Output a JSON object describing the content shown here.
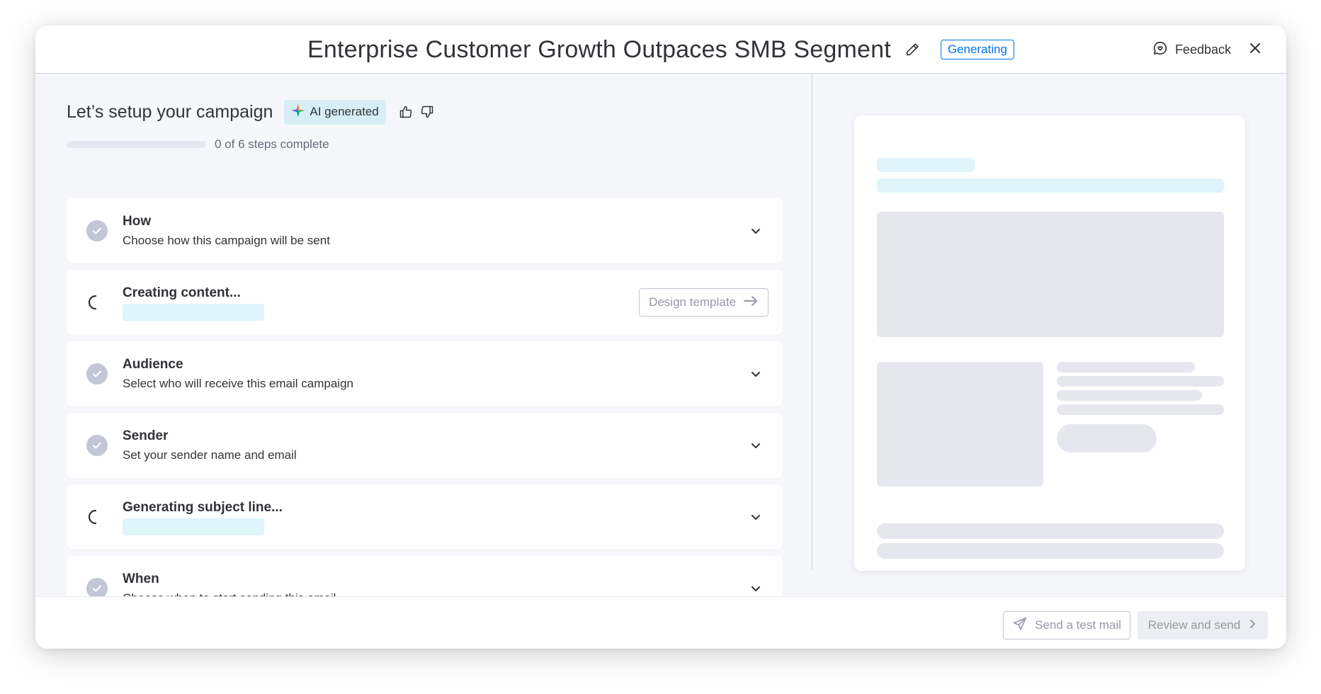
{
  "header": {
    "title": "Enterprise Customer Growth Outpaces SMB Segment",
    "status": "Generating",
    "feedback_label": "Feedback",
    "edit_icon": "pencil-icon",
    "close_icon": "close-icon"
  },
  "setup": {
    "title": "Let’s setup your campaign",
    "ai_badge": "AI generated",
    "progress_fraction": 0,
    "progress_text": "0 of 6 steps complete"
  },
  "steps": [
    {
      "title": "How",
      "subtitle": "Choose how this campaign will be sent",
      "state": "done"
    },
    {
      "title": "Creating content...",
      "subtitle": "",
      "state": "loading",
      "action_label": "Design template"
    },
    {
      "title": "Audience",
      "subtitle": "Select who will receive this email campaign",
      "state": "done"
    },
    {
      "title": "Sender",
      "subtitle": "Set your sender name and email",
      "state": "done"
    },
    {
      "title": "Generating subject line...",
      "subtitle": "",
      "state": "loading"
    },
    {
      "title": "When",
      "subtitle": "Choose when to start sending this email",
      "state": "done"
    }
  ],
  "footer": {
    "test_mail_label": "Send a test mail",
    "review_label": "Review and send"
  },
  "colors": {
    "accent": "#0073ea",
    "skeleton_cyan": "#def5fa",
    "skeleton_grey": "#e6e7ee",
    "check_grey": "#c3c6d4"
  }
}
